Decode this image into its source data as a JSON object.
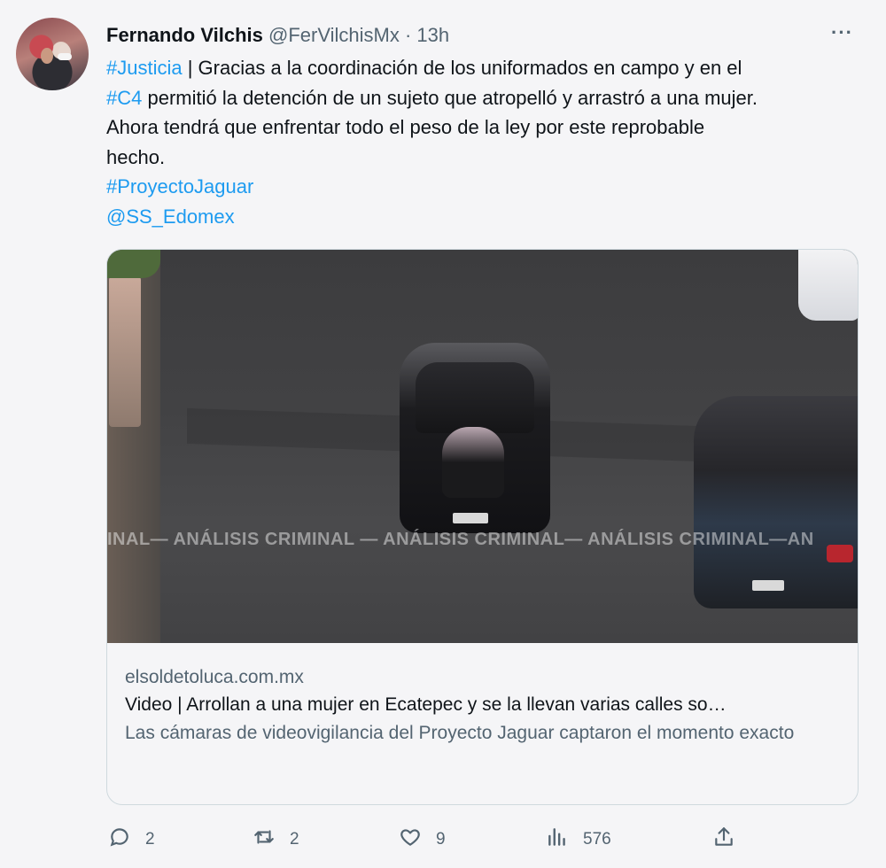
{
  "tweet": {
    "author_name": "Fernando Vilchis",
    "handle": "@FerVilchisMx",
    "separator": "·",
    "time": "13h",
    "more_icon": "more-horizontal-icon",
    "text": {
      "line1_tag": "#Justicia",
      "line1_rest": " | Gracias a la  coordinación de los uniformados en campo y en el",
      "line2_tag": "#C4",
      "line2_rest": " permitió la detención de un sujeto que atropelló y arrastró a una mujer.",
      "line3": "Ahora tendrá que enfrentar todo el peso de la ley por este reprobable",
      "line4": "hecho.",
      "tag2": "#ProyectoJaguar",
      "mention": "@SS_Edomex"
    }
  },
  "card": {
    "watermark": "INAL— ANÁLISIS CRIMINAL — ANÁLISIS CRIMINAL— ANÁLISIS CRIMINAL—AN",
    "domain": "elsoldetoluca.com.mx",
    "title": "Video | Arrollan a una mujer en Ecatepec y se la llevan varias calles so…",
    "description": "Las cámaras de videovigilancia del Proyecto Jaguar captaron el momento exacto"
  },
  "actions": {
    "reply": {
      "icon": "reply-icon",
      "count": "2"
    },
    "retweet": {
      "icon": "retweet-icon",
      "count": "2"
    },
    "like": {
      "icon": "heart-icon",
      "count": "9"
    },
    "views": {
      "icon": "views-icon",
      "count": "576"
    },
    "share": {
      "icon": "share-icon"
    }
  },
  "colors": {
    "link": "#1d9bf0",
    "secondary_text": "#536471",
    "primary_text": "#0f1419",
    "background": "#f5f5f7"
  }
}
